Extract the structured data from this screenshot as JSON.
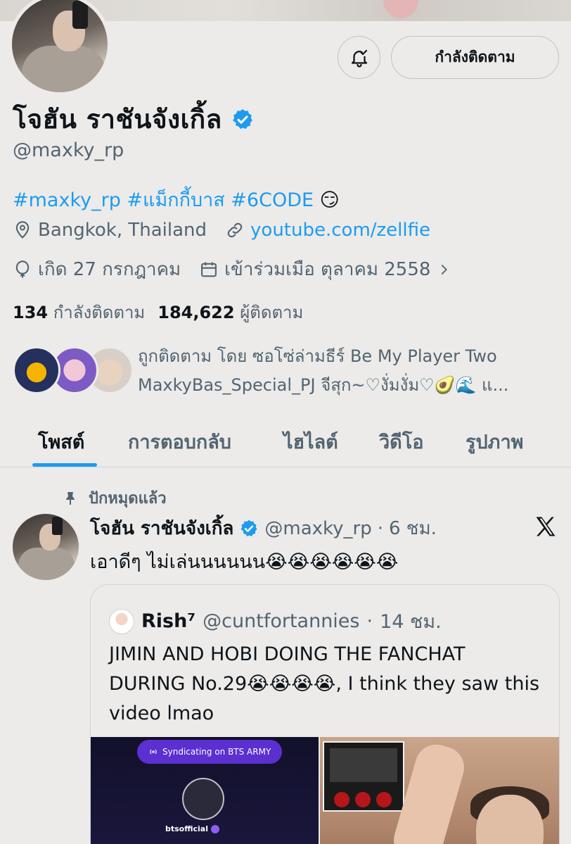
{
  "profile": {
    "display_name": "โจฮัน ราชันจังเกิ้ล",
    "handle": "@maxky_rp",
    "bio_tags": "#maxky_rp #แม็กกี้บาส #6CODE",
    "bio_emoji": "😏",
    "location": "Bangkok, Thailand",
    "website": "youtube.com/zellfie",
    "birthday": "เกิด 27 กรกฎาคม",
    "joined": "เข้าร่วมเมือ ตุลาคม 2558",
    "following_count": "134",
    "following_label": "กำลังติดตาม",
    "followers_count": "184,622",
    "followers_label": "ผู้ติดตาม",
    "followed_by_line1": "ถูกติดตาม โดย ซอโซ่ล่ามธีร์ Be My Player Two",
    "followed_by_line2": "MaxkyBas_Special_PJ จีสุก~♡งั่มงั่ม♡🥑🌊 แ..."
  },
  "actions": {
    "follow_label": "กำลังติดตาม"
  },
  "tabs": [
    {
      "label": "โพสต์",
      "active": true
    },
    {
      "label": "การตอบกลับ",
      "active": false
    },
    {
      "label": "ไฮไลต์",
      "active": false
    },
    {
      "label": "วิดีโอ",
      "active": false
    },
    {
      "label": "รูปภาพ",
      "active": false
    }
  ],
  "post": {
    "pinned_label": "ปักหมุดแล้ว",
    "author_name": "โจฮัน ราชันจังเกิ้ล",
    "author_handle": "@maxky_rp",
    "time": "6 ชม.",
    "text": "เอาดีๆ ไม่เล่นนนนนน😭😭😭😭😭😭",
    "quote": {
      "author_name": "Rish⁷",
      "author_handle": "@cuntfortannies",
      "time": "14 ชม.",
      "text": "JIMIN AND HOBI DOING THE FANCHAT DURING No.29😭😭😭😭, I think they saw this video lmao",
      "media_pill": "Syndicating on BTS ARMY",
      "media_caption": "btsofficial"
    }
  },
  "colors": {
    "background": "#ecebe9",
    "accent": "#1d9bf0",
    "secondary_text": "#536471"
  }
}
